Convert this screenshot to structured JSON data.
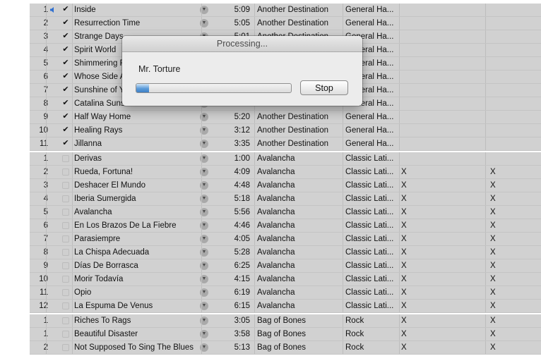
{
  "albums": [
    {
      "tracks": [
        {
          "num": "1",
          "checked": true,
          "playing": true,
          "name": "Inside",
          "time": "5:09",
          "album": "Another Destination",
          "genre": "General Ha...",
          "x1": "",
          "x2": ""
        },
        {
          "num": "2",
          "checked": true,
          "name": "Resurrection Time",
          "time": "5:05",
          "album": "Another Destination",
          "genre": "General Ha...",
          "x1": "",
          "x2": ""
        },
        {
          "num": "3",
          "checked": true,
          "name": "Strange Days",
          "time": "5:01",
          "album": "Another Destination",
          "genre": "General Ha...",
          "x1": "",
          "x2": ""
        },
        {
          "num": "4",
          "checked": true,
          "name": "Spirit World",
          "time": "",
          "album": "",
          "genre": "General Ha...",
          "x1": "",
          "x2": ""
        },
        {
          "num": "5",
          "checked": true,
          "name": "Shimmering Fields",
          "time": "",
          "album": "",
          "genre": "General Ha...",
          "x1": "",
          "x2": ""
        },
        {
          "num": "6",
          "checked": true,
          "name": "Whose Side Are You On",
          "time": "",
          "album": "",
          "genre": "General Ha...",
          "x1": "",
          "x2": ""
        },
        {
          "num": "7",
          "checked": true,
          "name": "Sunshine of Your Love",
          "time": "",
          "album": "",
          "genre": "General Ha...",
          "x1": "",
          "x2": ""
        },
        {
          "num": "8",
          "checked": true,
          "name": "Catalina Sunset",
          "time": "",
          "album": "",
          "genre": "General Ha...",
          "x1": "",
          "x2": ""
        },
        {
          "num": "9",
          "checked": true,
          "name": "Half Way Home",
          "time": "5:20",
          "album": "Another Destination",
          "genre": "General Ha...",
          "x1": "",
          "x2": ""
        },
        {
          "num": "10",
          "checked": true,
          "name": "Healing Rays",
          "time": "3:12",
          "album": "Another Destination",
          "genre": "General Ha...",
          "x1": "",
          "x2": ""
        },
        {
          "num": "11",
          "checked": true,
          "name": "Jillanna",
          "time": "3:35",
          "album": "Another Destination",
          "genre": "General Ha...",
          "x1": "",
          "x2": ""
        }
      ]
    },
    {
      "tracks": [
        {
          "num": "1",
          "checked": false,
          "name": "Derivas",
          "time": "1:00",
          "album": "Avalancha",
          "genre": "Classic Lati...",
          "x1": "",
          "x2": ""
        },
        {
          "num": "2",
          "checked": false,
          "name": "Rueda, Fortuna!",
          "time": "4:09",
          "album": "Avalancha",
          "genre": "Classic Lati...",
          "x1": "X",
          "x2": "X"
        },
        {
          "num": "3",
          "checked": false,
          "name": "Deshacer El Mundo",
          "time": "4:48",
          "album": "Avalancha",
          "genre": "Classic Lati...",
          "x1": "X",
          "x2": "X"
        },
        {
          "num": "4",
          "checked": false,
          "name": "Iberia Sumergida",
          "time": "5:18",
          "album": "Avalancha",
          "genre": "Classic Lati...",
          "x1": "X",
          "x2": "X"
        },
        {
          "num": "5",
          "checked": false,
          "name": "Avalancha",
          "time": "5:56",
          "album": "Avalancha",
          "genre": "Classic Lati...",
          "x1": "X",
          "x2": "X"
        },
        {
          "num": "6",
          "checked": false,
          "name": "En Los Brazos De La Fiebre",
          "time": "4:46",
          "album": "Avalancha",
          "genre": "Classic Lati...",
          "x1": "X",
          "x2": "X"
        },
        {
          "num": "7",
          "checked": false,
          "name": "Parasiempre",
          "time": "4:05",
          "album": "Avalancha",
          "genre": "Classic Lati...",
          "x1": "X",
          "x2": "X"
        },
        {
          "num": "8",
          "checked": false,
          "name": "La Chispa Adecuada",
          "time": "5:28",
          "album": "Avalancha",
          "genre": "Classic Lati...",
          "x1": "X",
          "x2": "X"
        },
        {
          "num": "9",
          "checked": false,
          "name": "Días De Borrasca",
          "time": "6:25",
          "album": "Avalancha",
          "genre": "Classic Lati...",
          "x1": "X",
          "x2": "X"
        },
        {
          "num": "10",
          "checked": false,
          "name": "Morir Todavía",
          "time": "4:15",
          "album": "Avalancha",
          "genre": "Classic Lati...",
          "x1": "X",
          "x2": "X"
        },
        {
          "num": "11",
          "checked": false,
          "name": "Opio",
          "time": "6:19",
          "album": "Avalancha",
          "genre": "Classic Lati...",
          "x1": "X",
          "x2": "X"
        },
        {
          "num": "12",
          "checked": false,
          "name": "La Espuma De Venus",
          "time": "6:15",
          "album": "Avalancha",
          "genre": "Classic Lati...",
          "x1": "X",
          "x2": "X"
        }
      ]
    },
    {
      "tracks": [
        {
          "num": "1",
          "checked": false,
          "name": "Riches To Rags",
          "time": "3:05",
          "album": "Bag of Bones",
          "genre": "Rock",
          "x1": "X",
          "x2": "X"
        },
        {
          "num": "1",
          "checked": false,
          "name": "Beautiful Disaster",
          "time": "3:58",
          "album": "Bag of Bones",
          "genre": "Rock",
          "x1": "X",
          "x2": "X"
        },
        {
          "num": "2",
          "checked": false,
          "name": "Not Supposed To Sing The Blues",
          "time": "5:13",
          "album": "Bag of Bones",
          "genre": "Rock",
          "x1": "X",
          "x2": "X"
        }
      ]
    }
  ],
  "dialog": {
    "title": "Processing...",
    "message": "Mr. Torture",
    "progress": 0.08,
    "stop_label": "Stop"
  },
  "icons": {
    "arrow": "circle-arrow-icon",
    "check": "checkmark-icon",
    "speaker": "speaker-icon"
  },
  "colors": {
    "row_bg": "#d1d1d1",
    "progress_fill": "#4a8fd6"
  }
}
